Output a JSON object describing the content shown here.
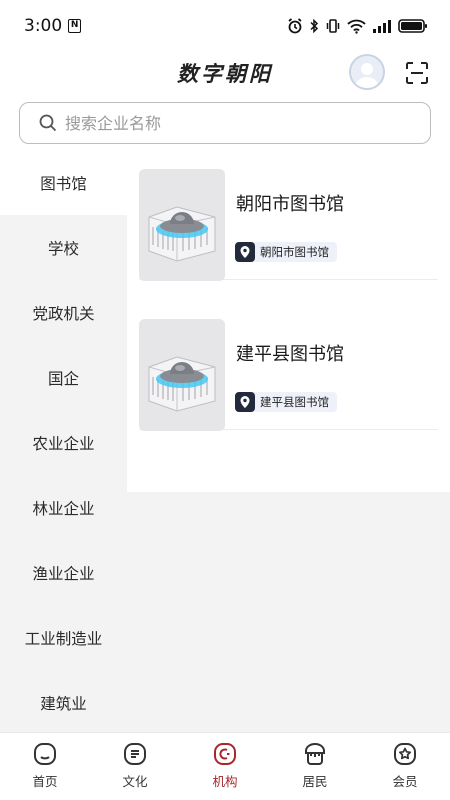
{
  "status_bar": {
    "time": "3:00",
    "battery": "full"
  },
  "header": {
    "title": "数字朝阳"
  },
  "search": {
    "placeholder": "搜索企业名称"
  },
  "sidebar": {
    "items": [
      {
        "label": "图书馆",
        "active": true
      },
      {
        "label": "学校",
        "active": false
      },
      {
        "label": "党政机关",
        "active": false
      },
      {
        "label": "国企",
        "active": false
      },
      {
        "label": "农业企业",
        "active": false
      },
      {
        "label": "林业企业",
        "active": false
      },
      {
        "label": "渔业企业",
        "active": false
      },
      {
        "label": "工业制造业",
        "active": false
      },
      {
        "label": "建筑业",
        "active": false
      }
    ]
  },
  "organizations": [
    {
      "name": "朝阳市图书馆",
      "tag": "朝阳市图书馆"
    },
    {
      "name": "建平县图书馆",
      "tag": "建平县图书馆"
    }
  ],
  "bottom_nav": {
    "items": [
      {
        "label": "首页",
        "icon": "home-icon",
        "active": false
      },
      {
        "label": "文化",
        "icon": "culture-icon",
        "active": false
      },
      {
        "label": "机构",
        "icon": "institution-icon",
        "active": true
      },
      {
        "label": "居民",
        "icon": "resident-icon",
        "active": false
      },
      {
        "label": "会员",
        "icon": "member-icon",
        "active": false
      }
    ]
  },
  "colors": {
    "accent": "#a7282c",
    "sidebar_bg": "#f3f3f3",
    "tag_bg": "#eef1f9"
  }
}
